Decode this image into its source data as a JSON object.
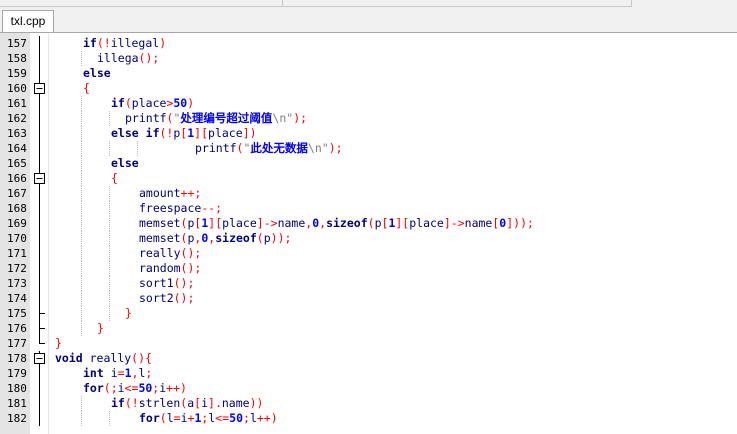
{
  "tab": {
    "label": "txl.cpp"
  },
  "lines": [
    {
      "num": "157",
      "fold": "v",
      "indent": 2,
      "tokens": [
        [
          "kw",
          "if"
        ],
        [
          "pu",
          "("
        ],
        [
          "pu",
          "!"
        ],
        [
          "tx",
          "illegal"
        ],
        [
          "pu",
          ")"
        ]
      ]
    },
    {
      "num": "158",
      "fold": "v",
      "indent": 3,
      "tokens": [
        [
          "tx",
          "illega"
        ],
        [
          "pu",
          "();"
        ]
      ]
    },
    {
      "num": "159",
      "fold": "v",
      "indent": 2,
      "tokens": [
        [
          "kw",
          "else"
        ]
      ]
    },
    {
      "num": "160",
      "fold": "box",
      "indent": 2,
      "tokens": [
        [
          "pu",
          "{"
        ]
      ]
    },
    {
      "num": "161",
      "fold": "v",
      "indent": 4,
      "tokens": [
        [
          "kw",
          "if"
        ],
        [
          "pu",
          "("
        ],
        [
          "tx",
          "place"
        ],
        [
          "pu",
          ">"
        ],
        [
          "cn",
          "50"
        ],
        [
          "pu",
          ")"
        ]
      ]
    },
    {
      "num": "162",
      "fold": "v",
      "indent": 5,
      "tokens": [
        [
          "tx",
          "printf"
        ],
        [
          "pu",
          "("
        ],
        [
          "st",
          "\""
        ],
        [
          "cn",
          "处理编号超过阈值"
        ],
        [
          "st",
          "\\n\""
        ],
        [
          "pu",
          ");"
        ]
      ]
    },
    {
      "num": "163",
      "fold": "v",
      "indent": 4,
      "tokens": [
        [
          "kw",
          "else"
        ],
        [
          "tx",
          " "
        ],
        [
          "kw",
          "if"
        ],
        [
          "pu",
          "(!"
        ],
        [
          "tx",
          "p"
        ],
        [
          "pu",
          "["
        ],
        [
          "cn",
          "1"
        ],
        [
          "pu",
          "]["
        ],
        [
          "tx",
          "place"
        ],
        [
          "pu",
          "])"
        ]
      ]
    },
    {
      "num": "164",
      "fold": "v",
      "indent": 10,
      "tokens": [
        [
          "tx",
          "printf"
        ],
        [
          "pu",
          "("
        ],
        [
          "st",
          "\""
        ],
        [
          "cn",
          "此处无数据"
        ],
        [
          "st",
          "\\n\""
        ],
        [
          "pu",
          ");"
        ]
      ]
    },
    {
      "num": "165",
      "fold": "v",
      "indent": 4,
      "tokens": [
        [
          "kw",
          "else"
        ]
      ]
    },
    {
      "num": "166",
      "fold": "box",
      "indent": 4,
      "tokens": [
        [
          "pu",
          "{"
        ]
      ]
    },
    {
      "num": "167",
      "fold": "v",
      "indent": 6,
      "tokens": [
        [
          "tx",
          "amount"
        ],
        [
          "pu",
          "++;"
        ]
      ]
    },
    {
      "num": "168",
      "fold": "v",
      "indent": 6,
      "tokens": [
        [
          "tx",
          "freespace"
        ],
        [
          "pu",
          "--;"
        ]
      ]
    },
    {
      "num": "169",
      "fold": "v",
      "indent": 6,
      "tokens": [
        [
          "tx",
          "memset"
        ],
        [
          "pu",
          "("
        ],
        [
          "tx",
          "p"
        ],
        [
          "pu",
          "["
        ],
        [
          "cn",
          "1"
        ],
        [
          "pu",
          "]["
        ],
        [
          "tx",
          "place"
        ],
        [
          "pu",
          "]->"
        ],
        [
          "tx",
          "name"
        ],
        [
          "pu",
          ","
        ],
        [
          "cn",
          "0"
        ],
        [
          "pu",
          ","
        ],
        [
          "kw",
          "sizeof"
        ],
        [
          "pu",
          "("
        ],
        [
          "tx",
          "p"
        ],
        [
          "pu",
          "["
        ],
        [
          "cn",
          "1"
        ],
        [
          "pu",
          "]["
        ],
        [
          "tx",
          "place"
        ],
        [
          "pu",
          "]->"
        ],
        [
          "tx",
          "name"
        ],
        [
          "pu",
          "["
        ],
        [
          "cn",
          "0"
        ],
        [
          "pu",
          "]));"
        ]
      ]
    },
    {
      "num": "170",
      "fold": "v",
      "indent": 6,
      "tokens": [
        [
          "tx",
          "memset"
        ],
        [
          "pu",
          "("
        ],
        [
          "tx",
          "p"
        ],
        [
          "pu",
          ","
        ],
        [
          "cn",
          "0"
        ],
        [
          "pu",
          ","
        ],
        [
          "kw",
          "sizeof"
        ],
        [
          "pu",
          "("
        ],
        [
          "tx",
          "p"
        ],
        [
          "pu",
          "));"
        ]
      ]
    },
    {
      "num": "171",
      "fold": "v",
      "indent": 6,
      "tokens": [
        [
          "tx",
          "really"
        ],
        [
          "pu",
          "();"
        ]
      ]
    },
    {
      "num": "172",
      "fold": "v",
      "indent": 6,
      "tokens": [
        [
          "tx",
          "random"
        ],
        [
          "pu",
          "();"
        ]
      ]
    },
    {
      "num": "173",
      "fold": "v",
      "indent": 6,
      "tokens": [
        [
          "tx",
          "sort1"
        ],
        [
          "pu",
          "();"
        ]
      ]
    },
    {
      "num": "174",
      "fold": "v",
      "indent": 6,
      "tokens": [
        [
          "tx",
          "sort2"
        ],
        [
          "pu",
          "();"
        ]
      ]
    },
    {
      "num": "175",
      "fold": "end",
      "indent": 5,
      "tokens": [
        [
          "pu",
          "}"
        ]
      ]
    },
    {
      "num": "176",
      "fold": "end",
      "indent": 3,
      "tokens": [
        [
          "pu",
          "}"
        ]
      ]
    },
    {
      "num": "177",
      "fold": "end",
      "indent": 0,
      "tokens": [
        [
          "pu",
          "}"
        ]
      ]
    },
    {
      "num": "178",
      "fold": "box",
      "indent": 0,
      "tokens": [
        [
          "kw",
          "void"
        ],
        [
          "tx",
          " really"
        ],
        [
          "pu",
          "(){"
        ]
      ]
    },
    {
      "num": "179",
      "fold": "v",
      "indent": 2,
      "tokens": [
        [
          "kw",
          "int"
        ],
        [
          "tx",
          " i"
        ],
        [
          "pu",
          "="
        ],
        [
          "cn",
          "1"
        ],
        [
          "pu",
          ","
        ],
        [
          "tx",
          "l"
        ],
        [
          "pu",
          ";"
        ]
      ]
    },
    {
      "num": "180",
      "fold": "v",
      "indent": 2,
      "tokens": [
        [
          "kw",
          "for"
        ],
        [
          "pu",
          "(;"
        ],
        [
          "tx",
          "i"
        ],
        [
          "pu",
          "<="
        ],
        [
          "cn",
          "50"
        ],
        [
          "pu",
          ";"
        ],
        [
          "tx",
          "i"
        ],
        [
          "pu",
          "++)"
        ]
      ]
    },
    {
      "num": "181",
      "fold": "v",
      "indent": 4,
      "tokens": [
        [
          "kw",
          "if"
        ],
        [
          "pu",
          "(!"
        ],
        [
          "tx",
          "strlen"
        ],
        [
          "pu",
          "("
        ],
        [
          "tx",
          "a"
        ],
        [
          "pu",
          "["
        ],
        [
          "tx",
          "i"
        ],
        [
          "pu",
          "]."
        ],
        [
          "tx",
          "name"
        ],
        [
          "pu",
          "))"
        ]
      ]
    },
    {
      "num": "182",
      "fold": "v",
      "indent": 6,
      "tokens": [
        [
          "kw",
          "for"
        ],
        [
          "pu",
          "("
        ],
        [
          "tx",
          "l"
        ],
        [
          "pu",
          "="
        ],
        [
          "tx",
          "i"
        ],
        [
          "pu",
          "+"
        ],
        [
          "cn",
          "1"
        ],
        [
          "pu",
          ";"
        ],
        [
          "tx",
          "l"
        ],
        [
          "pu",
          "<="
        ],
        [
          "cn",
          "50"
        ],
        [
          "pu",
          ";"
        ],
        [
          "tx",
          "l"
        ],
        [
          "pu",
          "++)"
        ]
      ]
    }
  ]
}
